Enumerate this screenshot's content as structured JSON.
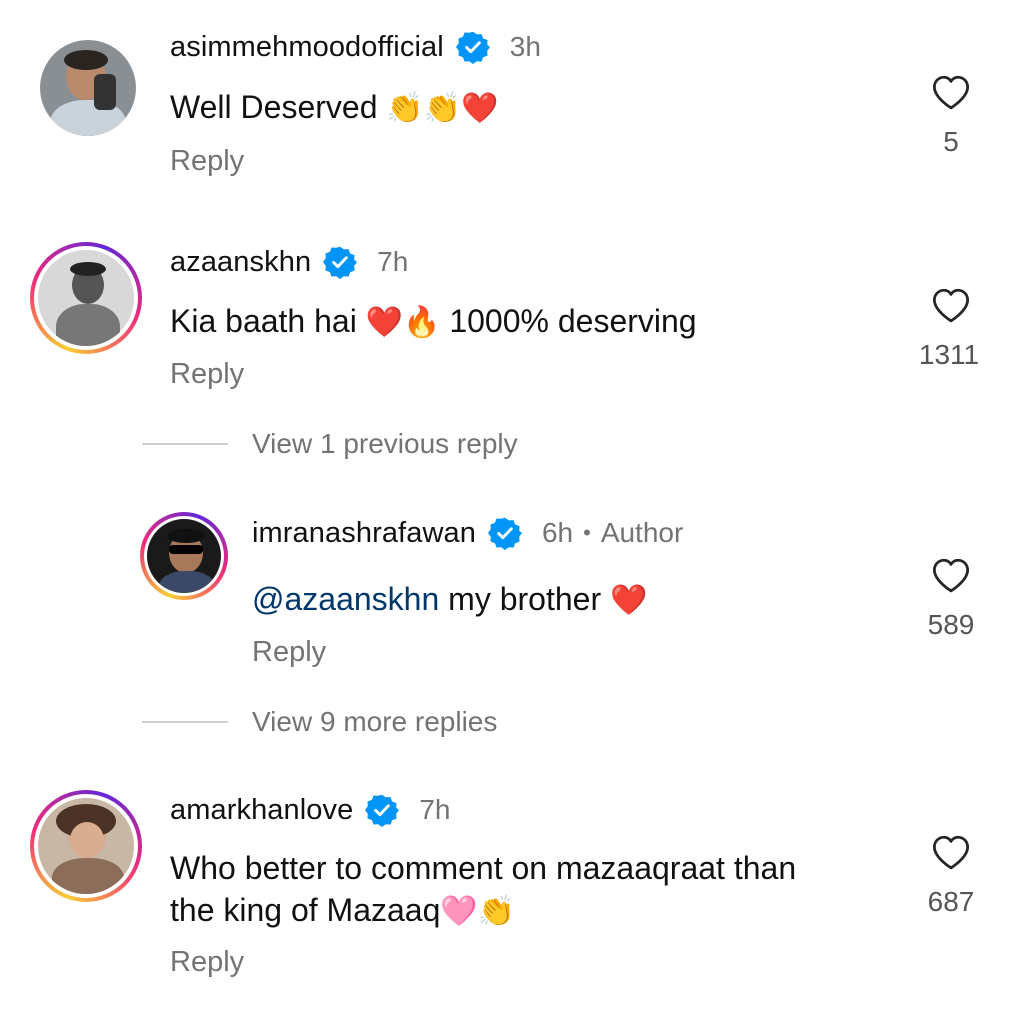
{
  "comments": [
    {
      "username": "asimmehmoodofficial",
      "time": "3h",
      "text": "Well Deserved",
      "emojis": "👏👏❤️",
      "reply_label": "Reply",
      "likes": "5",
      "avatar_ring": false
    },
    {
      "username": "azaanskhn",
      "time": "7h",
      "text_before": "Kia baath hai",
      "emojis": "❤️🔥",
      "text_after": "1000% deserving",
      "reply_label": "Reply",
      "likes": "1311",
      "avatar_ring": true
    },
    {
      "username": "imranashrafawan",
      "time": "6h",
      "dot": "•",
      "author_label": "Author",
      "mention": "@azaanskhn",
      "text": "my brother",
      "emojis": "❤️",
      "reply_label": "Reply",
      "likes": "589",
      "avatar_ring": true
    },
    {
      "username": "amarkhanlove",
      "time": "7h",
      "text_line1": "Who better to comment on mazaaqraat than",
      "text_line2": "the king of Mazaaq",
      "emojis": "🩷👏",
      "reply_label": "Reply",
      "likes": "687",
      "avatar_ring": true
    }
  ],
  "view_previous": "View 1 previous reply",
  "view_more": "View 9 more replies",
  "colors": {
    "verified": "#0095f6",
    "secondary_text": "#737373",
    "mention": "#00376b"
  }
}
